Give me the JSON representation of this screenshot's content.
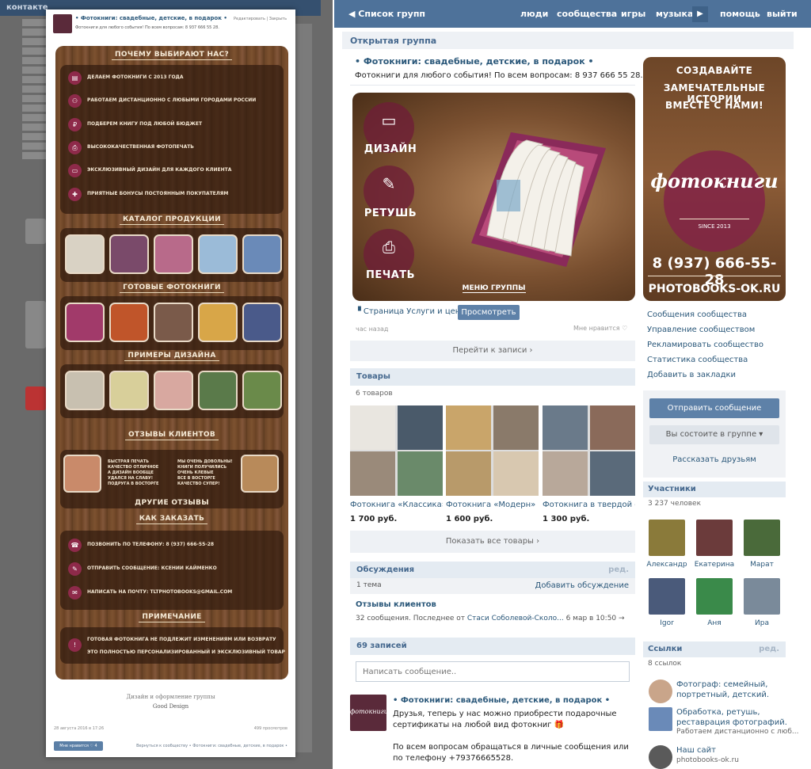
{
  "colors": {
    "vk_blue": "#4e729a",
    "link": "#2b587a",
    "button": "#5e81a8",
    "brand_burgundy": "#8e2a4a"
  },
  "background_page": {
    "logo": "контакте"
  },
  "modal": {
    "title": "• Фотокниги: свадебные, детские, в подарок •",
    "subtitle": "Фотокниги для любого события! По всем вопросам: 8 937 666 55 28.",
    "header_links": "Редактировать  |  Закрыть",
    "sections": {
      "why_title": "ПОЧЕМУ ВЫБИРАЮТ НАС?",
      "why_items": [
        {
          "icon": "book-icon",
          "text": "ДЕЛАЕМ ФОТОКНИГИ С 2013 ГОДА"
        },
        {
          "icon": "people-icon",
          "text": "РАБОТАЕМ ДИСТАНЦИОННО С ЛЮБЫМИ ГОРОДАМИ РОССИИ"
        },
        {
          "icon": "ruble-icon",
          "text": "ПОДБЕРЕМ КНИГУ ПОД ЛЮБОЙ БЮДЖЕТ"
        },
        {
          "icon": "printer-icon",
          "text": "ВЫСОКОКАЧЕСТВЕННАЯ ФОТОПЕЧАТЬ"
        },
        {
          "icon": "monitor-icon",
          "text": "ЭКСКЛЮЗИВНЫЙ ДИЗАЙН ДЛЯ КАЖДОГО КЛИЕНТА"
        },
        {
          "icon": "gift-icon",
          "text": "ПРИЯТНЫЕ БОНУСЫ ПОСТОЯННЫМ ПОКУПАТЕЛЯМ"
        }
      ],
      "catalog_title": "КАТАЛОГ ПРОДУКЦИИ",
      "ready_title": "ГОТОВЫЕ ФОТОКНИГИ",
      "examples_title": "ПРИМЕРЫ ДИЗАЙНА",
      "reviews_title": "ОТЗЫВЫ КЛИЕНТОВ",
      "review_1": "БЫСТРАЯ ПЕЧАТЬ\nКАЧЕСТВО ОТЛИЧНОЕ\nА ДИЗАЙН ВООБЩЕ\nУДАЛСЯ НА СЛАВУ!\nПОДРУГА В ВОСТОРГЕ",
      "review_2": "МЫ ОЧЕНЬ ДОВОЛЬНЫ!\nКНИГИ ПОЛУЧИЛИСЬ\nОЧЕНЬ КЛЕВЫЕ\nВСЕ В ВОСТОРГЕ\nКАЧЕСТВО СУПЕР!",
      "other_reviews": "ДРУГИЕ ОТЗЫВЫ",
      "order_title": "КАК ЗАКАЗАТЬ",
      "order_items": [
        {
          "icon": "phone-icon",
          "text": "ПОЗВОНИТЬ ПО ТЕЛЕФОНУ: 8 (937) 666-55-28"
        },
        {
          "icon": "edit-icon",
          "text": "ОТПРАВИТЬ СООБЩЕНИЕ: КСЕНИИ КАЙМЕНКО"
        },
        {
          "icon": "mail-icon",
          "text": "НАПИСАТЬ НА ПОЧТУ: TLTPHOTOBOOKS@GMAIL.COM"
        }
      ],
      "note_title": "ПРИМЕЧАНИЕ",
      "note_lines": [
        "ГОТОВАЯ ФОТОКНИГА НЕ ПОДЛЕЖИТ ИЗМЕНЕНИЯМ ИЛИ ВОЗВРАТУ",
        "ЭТО ПОЛНОСТЬЮ ПЕРСОНАЛИЗИРОВАННЫЙ И ЭКСКЛЮЗИВНЫЙ ТОВАР"
      ]
    },
    "design_credit": "Дизайн и оформление группы",
    "design_credit_name": "Good Design",
    "date": "28 августа 2016 в 17:26",
    "views": "499 просмотров",
    "like_button": "Мне нравится  ♡ 4",
    "back_link": "Вернуться к сообществу • Фотокниги: свадебные, детские, в подарок •"
  },
  "topbar": {
    "back": "◀  Список групп",
    "nav": [
      "люди",
      "сообщества",
      "игры",
      "музыка",
      "помощь",
      "выйти"
    ],
    "more": "▶"
  },
  "group": {
    "header": "Открытая группа",
    "title": "• Фотокниги: свадебные, детские, в подарок •",
    "status": "Фотокниги для любого события! По всем вопросам: 8 937 666 55 28.",
    "menu": {
      "items": [
        {
          "icon": "monitor-icon",
          "label": "ДИЗАЙН"
        },
        {
          "icon": "brush-icon",
          "label": "РЕТУШЬ"
        },
        {
          "icon": "printer-icon",
          "label": "ПЕЧАТЬ"
        }
      ],
      "footer": "МЕНЮ ГРУППЫ"
    },
    "wiki_link": "Страница Услуги и цены",
    "view_button": "Просмотреть",
    "time_ago": "час назад",
    "likes": "Мне нравится ♡",
    "go_to_post": "Перейти к записи ›",
    "goods": {
      "title": "Товары",
      "count": "6 товаров",
      "items": [
        {
          "name": "Фотокнига «Классика»",
          "price": "1 700 руб."
        },
        {
          "name": "Фотокнига «Модерн»",
          "price": "1 600 руб."
        },
        {
          "name": "Фотокнига в твердой об...",
          "price": "1 300 руб."
        }
      ],
      "show_all": "Показать все товары ›"
    },
    "discussions": {
      "title": "Обсуждения",
      "edit": "ред.",
      "count": "1 тема",
      "add": "Добавить обсуждение",
      "topic_title": "Отзывы клиентов",
      "topic_meta_prefix": "32 сообщения. Последнее от",
      "topic_author": "Стаси Соболевой-Сколо...",
      "topic_date": "6 мар в 10:50  →"
    },
    "wall": {
      "title": "69 записей",
      "placeholder": "Написать сообщение..",
      "post_avatar_text": "фотокниги",
      "post_author": "• Фотокниги: свадебные, детские, в подарок •",
      "post_text": "Друзья, теперь у нас можно приобрести подарочные сертификаты на любой вид фотокниг 🎁\n\nПо всем вопросам обращаться в личные сообщения или по телефону +79376665528."
    }
  },
  "cover": {
    "line1": "СОЗДАВАЙТЕ",
    "line2": "ЗАМЕЧАТЕЛЬНЫЕ ИСТОРИИ",
    "line3": "ВМЕСТЕ С НАМИ!",
    "logo": "фотокниги",
    "since": "SINCE 2013",
    "phone": "8 (937) 666-55-28",
    "site": "PHOTOBOOKS-OK.RU"
  },
  "admin_links": [
    "Сообщения сообщества",
    "Управление сообществом",
    "Рекламировать сообщество",
    "Статистика сообщества",
    "Добавить в закладки"
  ],
  "actions": {
    "send": "Отправить сообщение",
    "member": "Вы состоите в группе ▾",
    "tell": "Рассказать друзьям"
  },
  "members": {
    "title": "Участники",
    "count": "3 237 человек",
    "list": [
      {
        "name": "Александр",
        "color": "#8a7a3a"
      },
      {
        "name": "Екатерина",
        "color": "#6b3b3b"
      },
      {
        "name": "Марат",
        "color": "#4a6a3a"
      },
      {
        "name": "Igor",
        "color": "#4a5a7a"
      },
      {
        "name": "Аня",
        "color": "#3a8a4a"
      },
      {
        "name": "Ира",
        "color": "#7a8a9a"
      }
    ]
  },
  "links": {
    "title": "Ссылки",
    "edit": "ред.",
    "count": "8 ссылок",
    "items": [
      {
        "title": "Фотограф: семейный,\nпортретный, детский.",
        "sub": ""
      },
      {
        "title": "Обработка, ретушь,\nреставрация фотографий.",
        "sub": "Работаем дистанционно с люб..."
      },
      {
        "title": "Наш сайт",
        "sub": "photobooks-ok.ru"
      }
    ]
  }
}
